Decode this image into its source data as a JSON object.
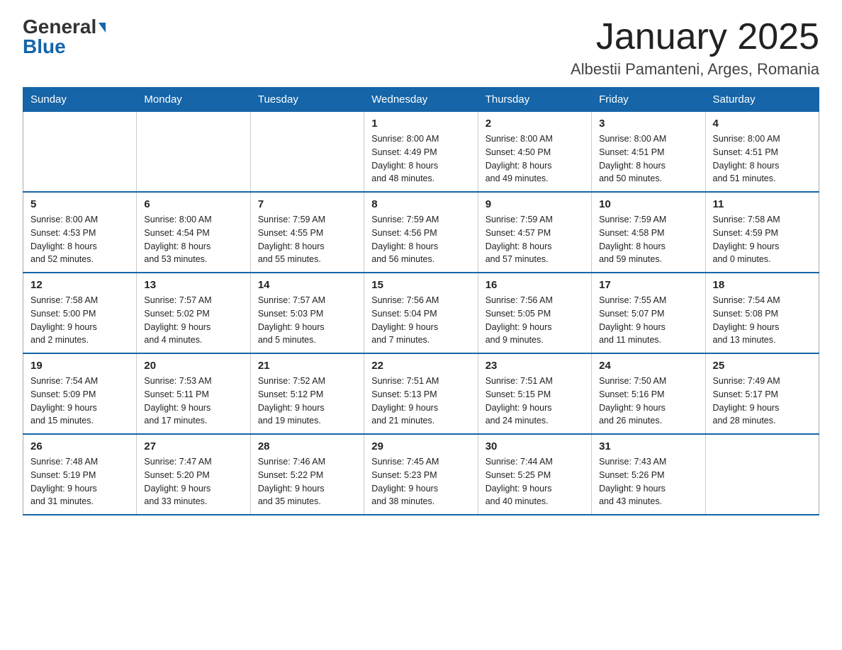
{
  "logo": {
    "general": "General",
    "blue": "Blue"
  },
  "title": "January 2025",
  "subtitle": "Albestii Pamanteni, Arges, Romania",
  "weekdays": [
    "Sunday",
    "Monday",
    "Tuesday",
    "Wednesday",
    "Thursday",
    "Friday",
    "Saturday"
  ],
  "weeks": [
    [
      {
        "day": "",
        "info": ""
      },
      {
        "day": "",
        "info": ""
      },
      {
        "day": "",
        "info": ""
      },
      {
        "day": "1",
        "info": "Sunrise: 8:00 AM\nSunset: 4:49 PM\nDaylight: 8 hours\nand 48 minutes."
      },
      {
        "day": "2",
        "info": "Sunrise: 8:00 AM\nSunset: 4:50 PM\nDaylight: 8 hours\nand 49 minutes."
      },
      {
        "day": "3",
        "info": "Sunrise: 8:00 AM\nSunset: 4:51 PM\nDaylight: 8 hours\nand 50 minutes."
      },
      {
        "day": "4",
        "info": "Sunrise: 8:00 AM\nSunset: 4:51 PM\nDaylight: 8 hours\nand 51 minutes."
      }
    ],
    [
      {
        "day": "5",
        "info": "Sunrise: 8:00 AM\nSunset: 4:53 PM\nDaylight: 8 hours\nand 52 minutes."
      },
      {
        "day": "6",
        "info": "Sunrise: 8:00 AM\nSunset: 4:54 PM\nDaylight: 8 hours\nand 53 minutes."
      },
      {
        "day": "7",
        "info": "Sunrise: 7:59 AM\nSunset: 4:55 PM\nDaylight: 8 hours\nand 55 minutes."
      },
      {
        "day": "8",
        "info": "Sunrise: 7:59 AM\nSunset: 4:56 PM\nDaylight: 8 hours\nand 56 minutes."
      },
      {
        "day": "9",
        "info": "Sunrise: 7:59 AM\nSunset: 4:57 PM\nDaylight: 8 hours\nand 57 minutes."
      },
      {
        "day": "10",
        "info": "Sunrise: 7:59 AM\nSunset: 4:58 PM\nDaylight: 8 hours\nand 59 minutes."
      },
      {
        "day": "11",
        "info": "Sunrise: 7:58 AM\nSunset: 4:59 PM\nDaylight: 9 hours\nand 0 minutes."
      }
    ],
    [
      {
        "day": "12",
        "info": "Sunrise: 7:58 AM\nSunset: 5:00 PM\nDaylight: 9 hours\nand 2 minutes."
      },
      {
        "day": "13",
        "info": "Sunrise: 7:57 AM\nSunset: 5:02 PM\nDaylight: 9 hours\nand 4 minutes."
      },
      {
        "day": "14",
        "info": "Sunrise: 7:57 AM\nSunset: 5:03 PM\nDaylight: 9 hours\nand 5 minutes."
      },
      {
        "day": "15",
        "info": "Sunrise: 7:56 AM\nSunset: 5:04 PM\nDaylight: 9 hours\nand 7 minutes."
      },
      {
        "day": "16",
        "info": "Sunrise: 7:56 AM\nSunset: 5:05 PM\nDaylight: 9 hours\nand 9 minutes."
      },
      {
        "day": "17",
        "info": "Sunrise: 7:55 AM\nSunset: 5:07 PM\nDaylight: 9 hours\nand 11 minutes."
      },
      {
        "day": "18",
        "info": "Sunrise: 7:54 AM\nSunset: 5:08 PM\nDaylight: 9 hours\nand 13 minutes."
      }
    ],
    [
      {
        "day": "19",
        "info": "Sunrise: 7:54 AM\nSunset: 5:09 PM\nDaylight: 9 hours\nand 15 minutes."
      },
      {
        "day": "20",
        "info": "Sunrise: 7:53 AM\nSunset: 5:11 PM\nDaylight: 9 hours\nand 17 minutes."
      },
      {
        "day": "21",
        "info": "Sunrise: 7:52 AM\nSunset: 5:12 PM\nDaylight: 9 hours\nand 19 minutes."
      },
      {
        "day": "22",
        "info": "Sunrise: 7:51 AM\nSunset: 5:13 PM\nDaylight: 9 hours\nand 21 minutes."
      },
      {
        "day": "23",
        "info": "Sunrise: 7:51 AM\nSunset: 5:15 PM\nDaylight: 9 hours\nand 24 minutes."
      },
      {
        "day": "24",
        "info": "Sunrise: 7:50 AM\nSunset: 5:16 PM\nDaylight: 9 hours\nand 26 minutes."
      },
      {
        "day": "25",
        "info": "Sunrise: 7:49 AM\nSunset: 5:17 PM\nDaylight: 9 hours\nand 28 minutes."
      }
    ],
    [
      {
        "day": "26",
        "info": "Sunrise: 7:48 AM\nSunset: 5:19 PM\nDaylight: 9 hours\nand 31 minutes."
      },
      {
        "day": "27",
        "info": "Sunrise: 7:47 AM\nSunset: 5:20 PM\nDaylight: 9 hours\nand 33 minutes."
      },
      {
        "day": "28",
        "info": "Sunrise: 7:46 AM\nSunset: 5:22 PM\nDaylight: 9 hours\nand 35 minutes."
      },
      {
        "day": "29",
        "info": "Sunrise: 7:45 AM\nSunset: 5:23 PM\nDaylight: 9 hours\nand 38 minutes."
      },
      {
        "day": "30",
        "info": "Sunrise: 7:44 AM\nSunset: 5:25 PM\nDaylight: 9 hours\nand 40 minutes."
      },
      {
        "day": "31",
        "info": "Sunrise: 7:43 AM\nSunset: 5:26 PM\nDaylight: 9 hours\nand 43 minutes."
      },
      {
        "day": "",
        "info": ""
      }
    ]
  ]
}
